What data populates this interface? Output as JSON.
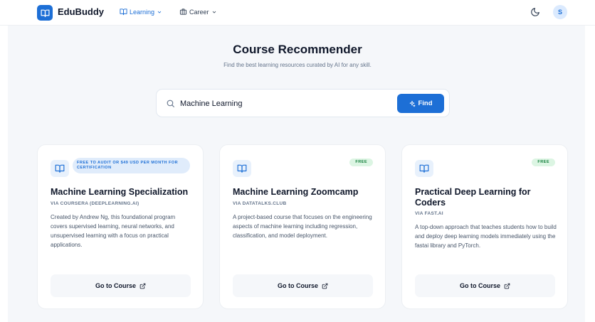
{
  "header": {
    "brand": "EduBuddy",
    "nav": [
      {
        "label": "Learning",
        "active": true
      },
      {
        "label": "Career",
        "active": false
      }
    ],
    "avatar_initial": "S"
  },
  "hero": {
    "title": "Course Recommender",
    "subtitle": "Find the best learning resources curated by AI for any skill."
  },
  "search": {
    "value": "Machine Learning",
    "button_label": "Find"
  },
  "courses": [
    {
      "badge": "FREE TO AUDIT OR $49 USD PER MONTH FOR CERTIFICATION",
      "title": "Machine Learning Specialization",
      "source": "VIA COURSERA (DEEPLEARNING.AI)",
      "description": "Created by Andrew Ng, this foundational program covers supervised learning, neural networks, and unsupervised learning with a focus on practical applications.",
      "button_label": "Go to Course"
    },
    {
      "badge": "FREE",
      "title": "Machine Learning Zoomcamp",
      "source": "VIA DATATALKS.CLUB",
      "description": "A project-based course that focuses on the engineering aspects of machine learning including regression, classification, and model deployment.",
      "button_label": "Go to Course"
    },
    {
      "badge": "FREE",
      "title": "Practical Deep Learning for Coders",
      "source": "VIA FAST.AI",
      "description": "A top-down approach that teaches students how to build and deploy deep learning models immediately using the fastai library and PyTorch.",
      "button_label": "Go to Course"
    }
  ],
  "colors": {
    "accent": "#1d6fd6",
    "background": "#f5f7fa",
    "free_badge_bg": "#dcf5e3",
    "free_badge_text": "#15803d"
  },
  "icons": [
    "book-open-icon",
    "chevron-down-icon",
    "briefcase-icon",
    "moon-icon",
    "search-icon",
    "sparkles-icon",
    "external-link-icon"
  ]
}
